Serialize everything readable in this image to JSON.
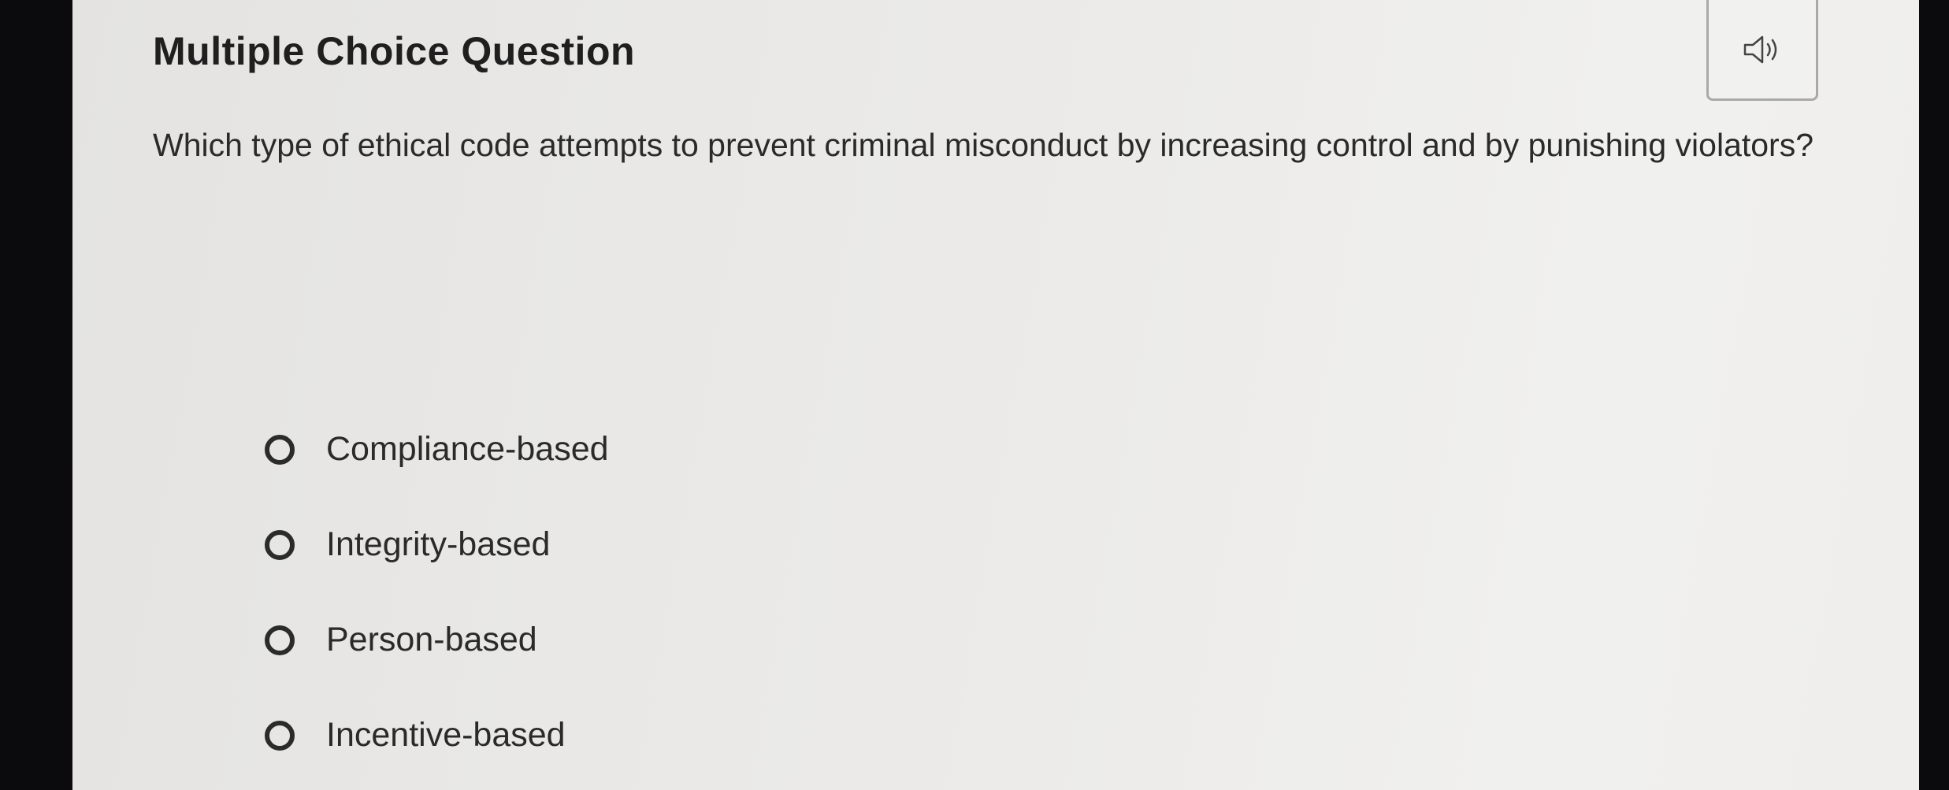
{
  "header": {
    "title": "Multiple Choice Question",
    "audio_icon": "speaker-icon"
  },
  "question": {
    "text": "Which type of ethical code attempts to prevent criminal misconduct by increasing control and by punishing violators?"
  },
  "choices": [
    {
      "label": "Compliance-based",
      "selected": false
    },
    {
      "label": "Integrity-based",
      "selected": false
    },
    {
      "label": "Person-based",
      "selected": false
    },
    {
      "label": "Incentive-based",
      "selected": false
    }
  ],
  "colors": {
    "background": "#ebeae8",
    "text": "#222222",
    "border": "#a9a9a9"
  }
}
